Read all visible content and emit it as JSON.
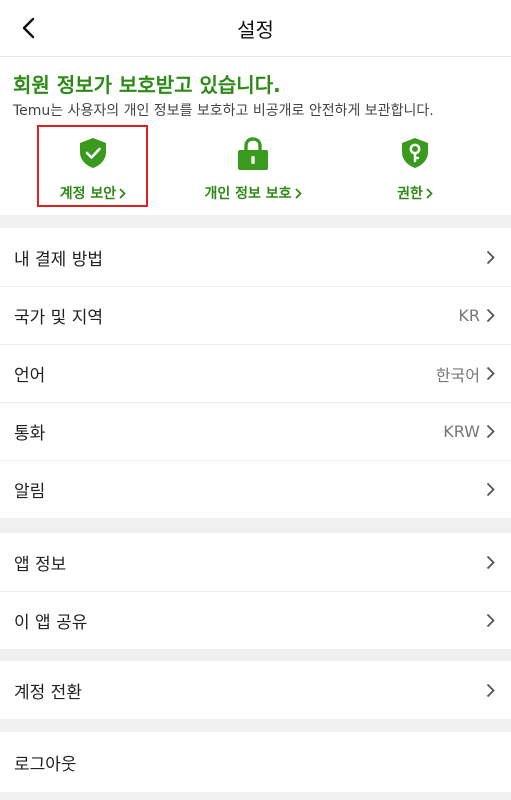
{
  "header": {
    "title": "설정"
  },
  "privacy": {
    "heading": "회원 정보가 보호받고 있습니다.",
    "description": "Temu는 사용자의 개인 정보를 보호하고 비공개로 안전하게 보관합니다.",
    "shortcuts": [
      {
        "label": "계정 보안",
        "icon": "shield-check-icon"
      },
      {
        "label": "개인 정보 보호",
        "icon": "lock-icon"
      },
      {
        "label": "권한",
        "icon": "shield-key-icon"
      }
    ]
  },
  "settings": [
    {
      "label": "내 결제 방법",
      "value": ""
    },
    {
      "label": "국가 및 지역",
      "value": "KR"
    },
    {
      "label": "언어",
      "value": "한국어"
    },
    {
      "label": "통화",
      "value": "KRW"
    },
    {
      "label": "알림",
      "value": ""
    }
  ],
  "about": [
    {
      "label": "앱 정보"
    },
    {
      "label": "이 앱 공유"
    }
  ],
  "account": {
    "switch_label": "계정 전환",
    "logout_label": "로그아웃"
  },
  "colors": {
    "accent": "#2e8a16",
    "highlight": "#e02020",
    "background": "#f0f0f0"
  }
}
